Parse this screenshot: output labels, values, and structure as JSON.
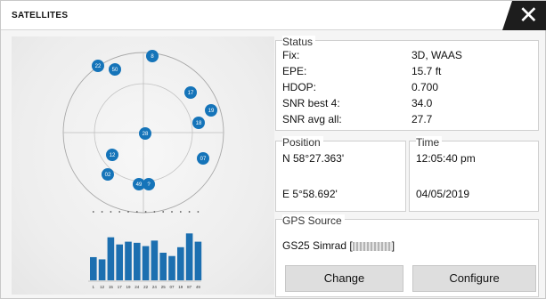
{
  "window": {
    "title": "SATELLITES",
    "close_glyph": "✕"
  },
  "colors": {
    "satellite": "#1574b9",
    "bar": "#1c6fb0",
    "text": "#111111"
  },
  "skyplot": {
    "satellites": [
      "8",
      "22",
      "50",
      "17",
      "18",
      "19",
      "28",
      "12",
      "07",
      "02",
      "49",
      "?"
    ],
    "bar_labels": [
      "1",
      "12",
      "15",
      "17",
      "19",
      "24",
      "22",
      "24",
      "25",
      "07",
      "19",
      "87",
      "49"
    ],
    "snr": [
      0.42,
      0.38,
      0.78,
      0.65,
      0.7,
      0.68,
      0.62,
      0.72,
      0.5,
      0.44,
      0.6,
      0.85,
      0.7
    ]
  },
  "status": {
    "label": "Status",
    "rows": [
      {
        "key": "Fix:",
        "value": "3D, WAAS"
      },
      {
        "key": "EPE:",
        "value": "15.7 ft"
      },
      {
        "key": "HDOP:",
        "value": "0.700"
      },
      {
        "key": "SNR best 4:",
        "value": "34.0"
      },
      {
        "key": "SNR avg all:",
        "value": "27.7"
      }
    ]
  },
  "position": {
    "label": "Position",
    "lat": "N  58°27.363'",
    "lon": "E  5°58.692'"
  },
  "time": {
    "label": "Time",
    "clock": "12:05:40 pm",
    "date": "04/05/2019"
  },
  "gps_source": {
    "label": "GPS Source",
    "device": "GS25 Simrad [",
    "device_suffix": "]"
  },
  "buttons": {
    "change": "Change",
    "configure": "Configure"
  }
}
